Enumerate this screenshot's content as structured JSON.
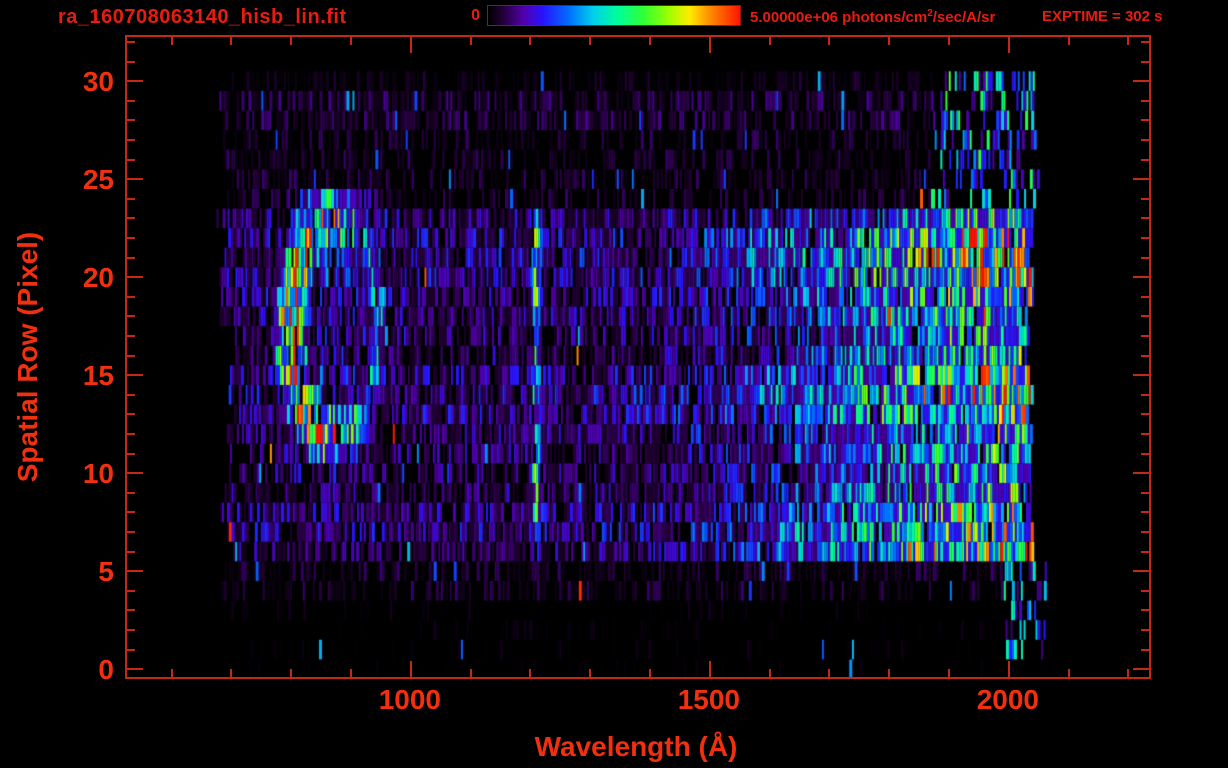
{
  "window": {
    "background": "#000000"
  },
  "colors": {
    "title_text": "#e81c10",
    "axis_labels": "#f0300f",
    "axis_lines": "#c42816"
  },
  "chart_data": {
    "type": "heatmap",
    "title": "ra_160708063140_hisb_lin.fit",
    "xlabel": "Wavelength (Å)",
    "ylabel": "Spatial Row (Pixel)",
    "exptime": "EXPTIME = 302 s",
    "xlim": [
      527,
      2236
    ],
    "ylim": [
      -0.4,
      32.25
    ],
    "xticks": [
      1000,
      1500,
      2000
    ],
    "xtick_labels": [
      "1000",
      "1500",
      "2000"
    ],
    "x_minor_step": 100,
    "x_minor_range": [
      600,
      2200
    ],
    "yticks": [
      0,
      5,
      10,
      15,
      20,
      25,
      30
    ],
    "ytick_labels": [
      "0",
      "5",
      "10",
      "15",
      "20",
      "25",
      "30"
    ],
    "y_minor_step": 1,
    "grid": false,
    "colorbar": {
      "min_label": "0",
      "max_label_prefix": "5.00000e+06 photons/cm",
      "max_label_sup": "2",
      "max_label_suffix": "/sec/A/sr",
      "min_value": 0,
      "max_value": 5000000,
      "units": "photons/cm^2/sec/A/sr",
      "position": "top",
      "stops": [
        [
          0.0,
          "#000000"
        ],
        [
          0.06,
          "#230037"
        ],
        [
          0.14,
          "#5000aa"
        ],
        [
          0.22,
          "#2814ff"
        ],
        [
          0.32,
          "#006eff"
        ],
        [
          0.42,
          "#00d2eb"
        ],
        [
          0.52,
          "#00ff96"
        ],
        [
          0.62,
          "#32ff32"
        ],
        [
          0.72,
          "#a0ff00"
        ],
        [
          0.8,
          "#ffeb00"
        ],
        [
          0.88,
          "#ff8c00"
        ],
        [
          1.0,
          "#ff1400"
        ]
      ]
    },
    "image_model": {
      "description": "UV long-slit spectral image: 31 spatial rows x wavelength 676-2036 A, striped photon-count noise",
      "lambda_data_start": 676,
      "lambda_data_cutoff": 2036,
      "rows": 31,
      "row_boosts": {
        "6": 6,
        "7": 8,
        "8": 4,
        "9": -3,
        "10": -5,
        "11": -3,
        "12": 0,
        "13": 7,
        "14": 9,
        "15": 7,
        "16": -4,
        "17": -4,
        "18": 0,
        "19": 2,
        "20": 9,
        "21": 12,
        "22": 9,
        "23": -2
      },
      "continuum": {
        "ramp_start": 1240,
        "ramp_end": 1940,
        "ramp_gain": 40,
        "rows": [
          6,
          23
        ]
      },
      "upper_rows_bright": {
        "rows": [
          24,
          30
        ],
        "lambda_min": 1870,
        "level": 40
      },
      "lower_tail": {
        "rows": [
          1,
          5
        ],
        "lambda_min": 1990,
        "level": 33
      },
      "crescent": {
        "center_lambda": 872,
        "center_row": 17.4,
        "radius_lambda": 74,
        "radius_row": 5.55,
        "ring_width": 0.3,
        "amp_min": 34,
        "amp_max": 104,
        "interior_level": 15,
        "halo_level": 16
      },
      "emission_line": {
        "lambda": 1210,
        "sigma": 9,
        "amp": 44,
        "rows": [
          6,
          23
        ],
        "bright_rows": [
          [
            8,
            12,
            1.15
          ],
          [
            18,
            22,
            1.2
          ]
        ],
        "dim_rows": [
          [
            6,
            7,
            0.75
          ],
          [
            13,
            13,
            0.8
          ]
        ]
      },
      "edge_spikes": {
        "rows": [
          6,
          28
        ],
        "level": 92,
        "probability": 0.1
      },
      "noise_seed": 987654321
    }
  }
}
